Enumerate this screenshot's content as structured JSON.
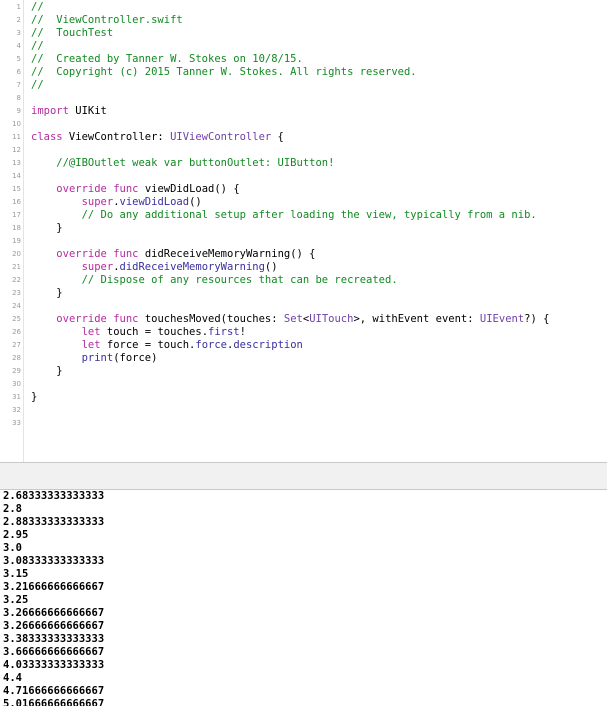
{
  "editor": {
    "lines": [
      {
        "n": "1",
        "tokens": [
          {
            "t": "//",
            "c": "comment"
          }
        ]
      },
      {
        "n": "2",
        "tokens": [
          {
            "t": "//  ViewController.swift",
            "c": "comment"
          }
        ]
      },
      {
        "n": "3",
        "tokens": [
          {
            "t": "//  TouchTest",
            "c": "comment"
          }
        ]
      },
      {
        "n": "4",
        "tokens": [
          {
            "t": "//",
            "c": "comment"
          }
        ]
      },
      {
        "n": "5",
        "tokens": [
          {
            "t": "//  Created by Tanner W. Stokes on 10/8/15.",
            "c": "comment"
          }
        ]
      },
      {
        "n": "6",
        "tokens": [
          {
            "t": "//  Copyright (c) 2015 Tanner W. Stokes. All rights reserved.",
            "c": "comment"
          }
        ]
      },
      {
        "n": "7",
        "tokens": [
          {
            "t": "//",
            "c": "comment"
          }
        ]
      },
      {
        "n": "8",
        "tokens": []
      },
      {
        "n": "9",
        "tokens": [
          {
            "t": "import",
            "c": "keyword"
          },
          {
            "t": " UIKit",
            "c": "plain"
          }
        ]
      },
      {
        "n": "10",
        "tokens": []
      },
      {
        "n": "11",
        "tokens": [
          {
            "t": "class",
            "c": "keyword"
          },
          {
            "t": " ViewController: ",
            "c": "plain"
          },
          {
            "t": "UIViewController",
            "c": "type"
          },
          {
            "t": " {",
            "c": "plain"
          }
        ]
      },
      {
        "n": "12",
        "tokens": []
      },
      {
        "n": "13",
        "tokens": [
          {
            "t": "    //@IBOutlet weak var buttonOutlet: UIButton!",
            "c": "comment"
          }
        ]
      },
      {
        "n": "14",
        "tokens": []
      },
      {
        "n": "15",
        "tokens": [
          {
            "t": "    ",
            "c": "plain"
          },
          {
            "t": "override",
            "c": "keyword"
          },
          {
            "t": " ",
            "c": "plain"
          },
          {
            "t": "func",
            "c": "keyword"
          },
          {
            "t": " viewDidLoad() {",
            "c": "plain"
          }
        ]
      },
      {
        "n": "16",
        "tokens": [
          {
            "t": "        ",
            "c": "plain"
          },
          {
            "t": "super",
            "c": "keyword"
          },
          {
            "t": ".",
            "c": "plain"
          },
          {
            "t": "viewDidLoad",
            "c": "member"
          },
          {
            "t": "()",
            "c": "plain"
          }
        ]
      },
      {
        "n": "17",
        "tokens": [
          {
            "t": "        // Do any additional setup after loading the view, typically from a nib.",
            "c": "comment"
          }
        ]
      },
      {
        "n": "18",
        "tokens": [
          {
            "t": "    }",
            "c": "plain"
          }
        ]
      },
      {
        "n": "19",
        "tokens": []
      },
      {
        "n": "20",
        "tokens": [
          {
            "t": "    ",
            "c": "plain"
          },
          {
            "t": "override",
            "c": "keyword"
          },
          {
            "t": " ",
            "c": "plain"
          },
          {
            "t": "func",
            "c": "keyword"
          },
          {
            "t": " didReceiveMemoryWarning() {",
            "c": "plain"
          }
        ]
      },
      {
        "n": "21",
        "tokens": [
          {
            "t": "        ",
            "c": "plain"
          },
          {
            "t": "super",
            "c": "keyword"
          },
          {
            "t": ".",
            "c": "plain"
          },
          {
            "t": "didReceiveMemoryWarning",
            "c": "member"
          },
          {
            "t": "()",
            "c": "plain"
          }
        ]
      },
      {
        "n": "22",
        "tokens": [
          {
            "t": "        // Dispose of any resources that can be recreated.",
            "c": "comment"
          }
        ]
      },
      {
        "n": "23",
        "tokens": [
          {
            "t": "    }",
            "c": "plain"
          }
        ]
      },
      {
        "n": "24",
        "tokens": []
      },
      {
        "n": "25",
        "tokens": [
          {
            "t": "    ",
            "c": "plain"
          },
          {
            "t": "override",
            "c": "keyword"
          },
          {
            "t": " ",
            "c": "plain"
          },
          {
            "t": "func",
            "c": "keyword"
          },
          {
            "t": " touchesMoved(touches: ",
            "c": "plain"
          },
          {
            "t": "Set",
            "c": "type"
          },
          {
            "t": "<",
            "c": "plain"
          },
          {
            "t": "UITouch",
            "c": "type"
          },
          {
            "t": ">, withEvent event: ",
            "c": "plain"
          },
          {
            "t": "UIEvent",
            "c": "type"
          },
          {
            "t": "?) {",
            "c": "plain"
          }
        ]
      },
      {
        "n": "26",
        "tokens": [
          {
            "t": "        ",
            "c": "plain"
          },
          {
            "t": "let",
            "c": "keyword"
          },
          {
            "t": " touch = touches.",
            "c": "plain"
          },
          {
            "t": "first",
            "c": "member"
          },
          {
            "t": "!",
            "c": "plain"
          }
        ]
      },
      {
        "n": "27",
        "tokens": [
          {
            "t": "        ",
            "c": "plain"
          },
          {
            "t": "let",
            "c": "keyword"
          },
          {
            "t": " force = touch.",
            "c": "plain"
          },
          {
            "t": "force",
            "c": "member"
          },
          {
            "t": ".",
            "c": "plain"
          },
          {
            "t": "description",
            "c": "member"
          }
        ]
      },
      {
        "n": "28",
        "tokens": [
          {
            "t": "        ",
            "c": "plain"
          },
          {
            "t": "print",
            "c": "member"
          },
          {
            "t": "(force)",
            "c": "plain"
          }
        ]
      },
      {
        "n": "29",
        "tokens": [
          {
            "t": "    }",
            "c": "plain"
          }
        ]
      },
      {
        "n": "30",
        "tokens": []
      },
      {
        "n": "31",
        "tokens": [
          {
            "t": "}",
            "c": "plain"
          }
        ]
      },
      {
        "n": "32",
        "tokens": []
      },
      {
        "n": "33",
        "tokens": []
      }
    ]
  },
  "console": {
    "lines": [
      "2.68333333333333",
      "2.8",
      "2.88333333333333",
      "2.95",
      "3.0",
      "3.08333333333333",
      "3.15",
      "3.21666666666667",
      "3.25",
      "3.26666666666667",
      "3.26666666666667",
      "3.38333333333333",
      "3.66666666666667",
      "4.03333333333333",
      "4.4",
      "4.71666666666667",
      "5.01666666666667"
    ]
  },
  "colors": {
    "comment": "#128a22",
    "keyword": "#b42ba1",
    "type": "#6f41a7",
    "member": "#3a2f9f",
    "plain": "#000000"
  }
}
